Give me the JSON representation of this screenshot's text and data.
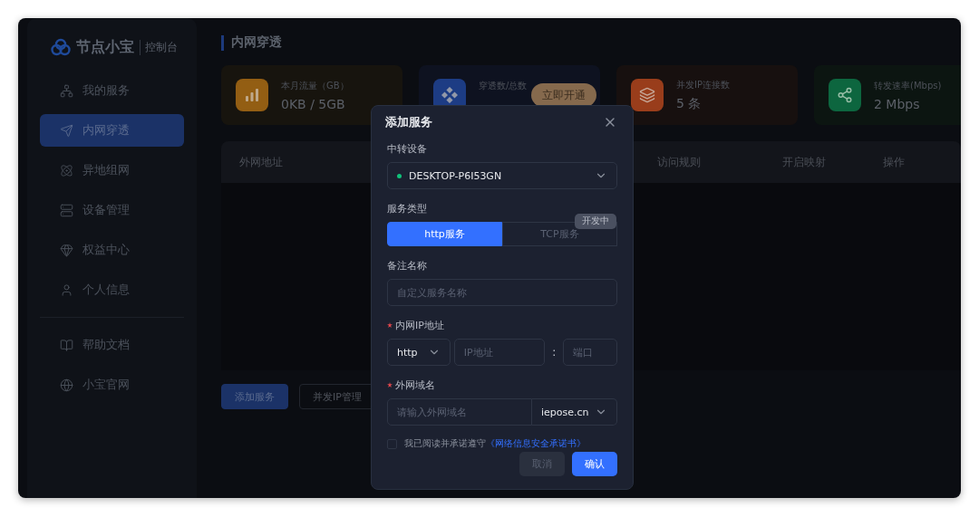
{
  "brand": {
    "name": "节点小宝",
    "subtitle": "控制台"
  },
  "sidebar": {
    "groups": [
      [
        {
          "label": "我的服务",
          "selected": false
        },
        {
          "label": "内网穿透",
          "selected": true
        },
        {
          "label": "异地组网",
          "selected": false
        },
        {
          "label": "设备管理",
          "selected": false
        },
        {
          "label": "权益中心",
          "selected": false
        },
        {
          "label": "个人信息",
          "selected": false
        }
      ],
      [
        {
          "label": "帮助文档",
          "selected": false
        },
        {
          "label": "小宝官网",
          "selected": false
        }
      ]
    ]
  },
  "page_title": "内网穿透",
  "stats": [
    {
      "label": "本月流量（GB）",
      "value": "0KB / 5GB",
      "color": "#9a6214"
    },
    {
      "label": "穿透数/总数",
      "color": "#1e3f8a",
      "action": "立即开通"
    },
    {
      "label": "并发IP连接数",
      "value": "5 条",
      "color": "#a0401c"
    },
    {
      "label": "转发速率(Mbps)",
      "value": "2 Mbps",
      "color": "#0e6b42"
    }
  ],
  "table": {
    "columns": [
      "外网地址",
      "访问规则",
      "开启映射",
      "操作"
    ]
  },
  "buttons": [
    {
      "label": "添加服务",
      "kind": "primary"
    },
    {
      "label": "并发IP管理",
      "kind": "outline"
    }
  ],
  "dialog": {
    "title": "添加服务",
    "relay_device": {
      "label": "中转设备",
      "value": "DESKTOP-P6I53GN",
      "online": true
    },
    "service_type": {
      "label": "服务类型",
      "options": [
        {
          "label": "http服务",
          "selected": true
        },
        {
          "label": "TCP服务",
          "selected": false
        }
      ],
      "badge": "开发中"
    },
    "remark": {
      "label": "备注名称",
      "placeholder": "自定义服务名称"
    },
    "lan_address": {
      "label": "内网IP地址",
      "required": true,
      "protocol": "http",
      "ip_placeholder": "IP地址",
      "separator": ":",
      "port_placeholder": "端口"
    },
    "domain": {
      "label": "外网域名",
      "required": true,
      "placeholder": "请输入外网域名",
      "suffix": "iepose.cn"
    },
    "agreement": {
      "checked": false,
      "text": "我已阅读并承诺遵守",
      "link": "《网络信息安全承诺书》"
    },
    "buttons": [
      {
        "label": "取消",
        "kind": "secondary"
      },
      {
        "label": "确认",
        "kind": "primary"
      }
    ]
  }
}
